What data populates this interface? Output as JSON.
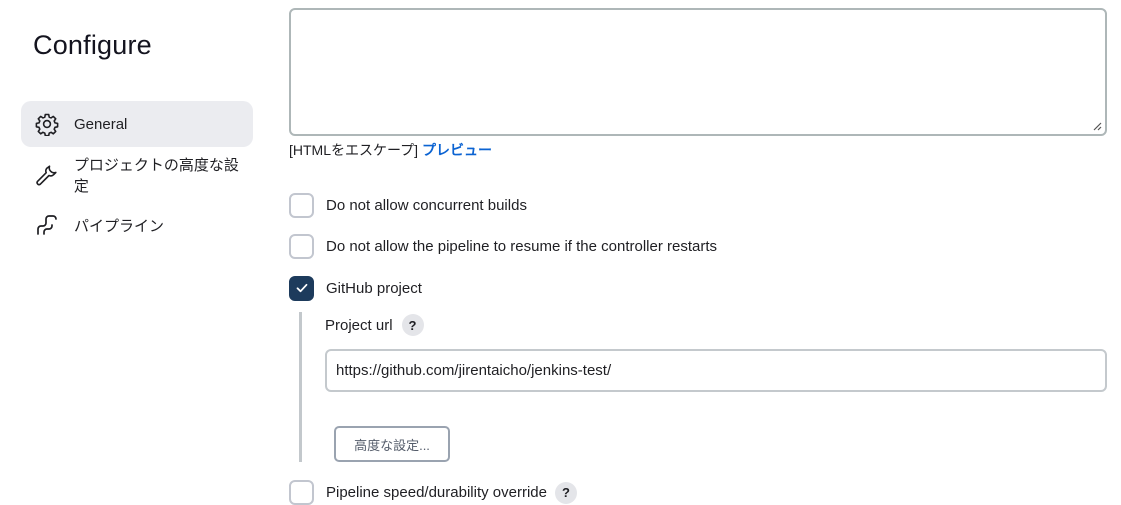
{
  "sidebar": {
    "title": "Configure",
    "items": [
      {
        "label": "General",
        "icon": "gear-icon",
        "active": true
      },
      {
        "label": "プロジェクトの高度な設定",
        "icon": "wrench-icon",
        "active": false
      },
      {
        "label": "パイプライン",
        "icon": "pipeline-icon",
        "active": false
      }
    ]
  },
  "description": {
    "value": "",
    "escape_text": "[HTMLをエスケープ]",
    "preview_label": "プレビュー"
  },
  "options": [
    {
      "label": "Do not allow concurrent builds",
      "checked": false
    },
    {
      "label": "Do not allow the pipeline to resume if the controller restarts",
      "checked": false
    },
    {
      "label": "GitHub project",
      "checked": true
    }
  ],
  "github_project": {
    "url_label": "Project url",
    "help": "?",
    "url_value": "https://github.com/jirentaicho/jenkins-test/",
    "advanced_label": "高度な設定..."
  },
  "cut_option": {
    "label": "Pipeline speed/durability override",
    "help": "?",
    "checked": false
  },
  "colors": {
    "accent_checked": "#1d3b5c",
    "link": "#0b63d2",
    "active_nav_bg": "#ebecf0"
  }
}
